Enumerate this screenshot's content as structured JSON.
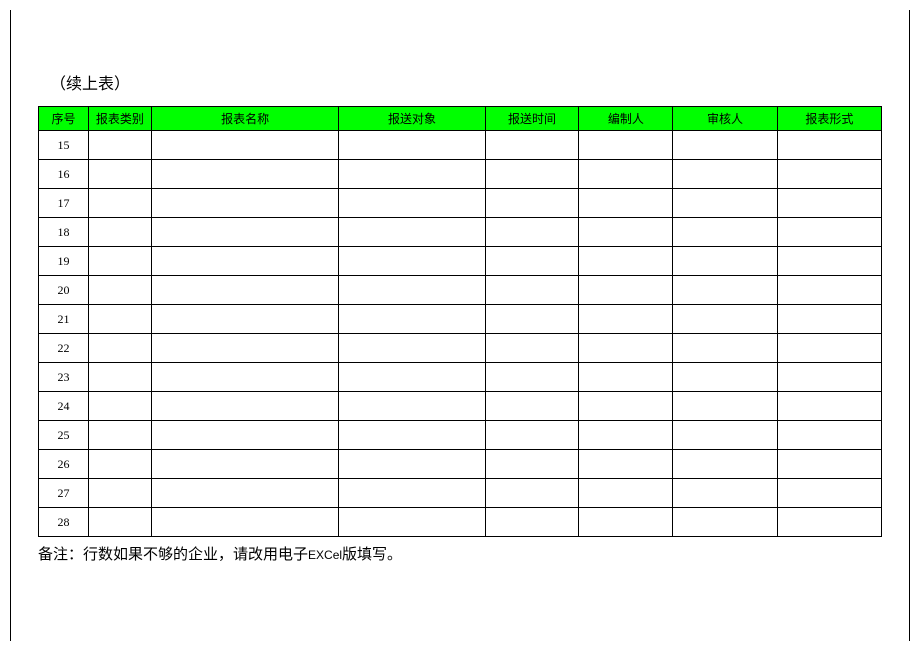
{
  "caption": "（续上表）",
  "headers": {
    "seq": "序号",
    "type": "报表类别",
    "name": "报表名称",
    "target": "报送对象",
    "time": "报送时间",
    "preparer": "编制人",
    "reviewer": "审核人",
    "form": "报表形式"
  },
  "rows": [
    {
      "seq": "15",
      "type": "",
      "name": "",
      "target": "",
      "time": "",
      "preparer": "",
      "reviewer": "",
      "form": ""
    },
    {
      "seq": "16",
      "type": "",
      "name": "",
      "target": "",
      "time": "",
      "preparer": "",
      "reviewer": "",
      "form": ""
    },
    {
      "seq": "17",
      "type": "",
      "name": "",
      "target": "",
      "time": "",
      "preparer": "",
      "reviewer": "",
      "form": ""
    },
    {
      "seq": "18",
      "type": "",
      "name": "",
      "target": "",
      "time": "",
      "preparer": "",
      "reviewer": "",
      "form": ""
    },
    {
      "seq": "19",
      "type": "",
      "name": "",
      "target": "",
      "time": "",
      "preparer": "",
      "reviewer": "",
      "form": ""
    },
    {
      "seq": "20",
      "type": "",
      "name": "",
      "target": "",
      "time": "",
      "preparer": "",
      "reviewer": "",
      "form": ""
    },
    {
      "seq": "21",
      "type": "",
      "name": "",
      "target": "",
      "time": "",
      "preparer": "",
      "reviewer": "",
      "form": ""
    },
    {
      "seq": "22",
      "type": "",
      "name": "",
      "target": "",
      "time": "",
      "preparer": "",
      "reviewer": "",
      "form": ""
    },
    {
      "seq": "23",
      "type": "",
      "name": "",
      "target": "",
      "time": "",
      "preparer": "",
      "reviewer": "",
      "form": ""
    },
    {
      "seq": "24",
      "type": "",
      "name": "",
      "target": "",
      "time": "",
      "preparer": "",
      "reviewer": "",
      "form": ""
    },
    {
      "seq": "25",
      "type": "",
      "name": "",
      "target": "",
      "time": "",
      "preparer": "",
      "reviewer": "",
      "form": ""
    },
    {
      "seq": "26",
      "type": "",
      "name": "",
      "target": "",
      "time": "",
      "preparer": "",
      "reviewer": "",
      "form": ""
    },
    {
      "seq": "27",
      "type": "",
      "name": "",
      "target": "",
      "time": "",
      "preparer": "",
      "reviewer": "",
      "form": ""
    },
    {
      "seq": "28",
      "type": "",
      "name": "",
      "target": "",
      "time": "",
      "preparer": "",
      "reviewer": "",
      "form": ""
    }
  ],
  "footnote": {
    "prefix": "备注：行数如果不够的企业，请改用电子",
    "excel": "EXCel",
    "suffix": "版填写。"
  }
}
